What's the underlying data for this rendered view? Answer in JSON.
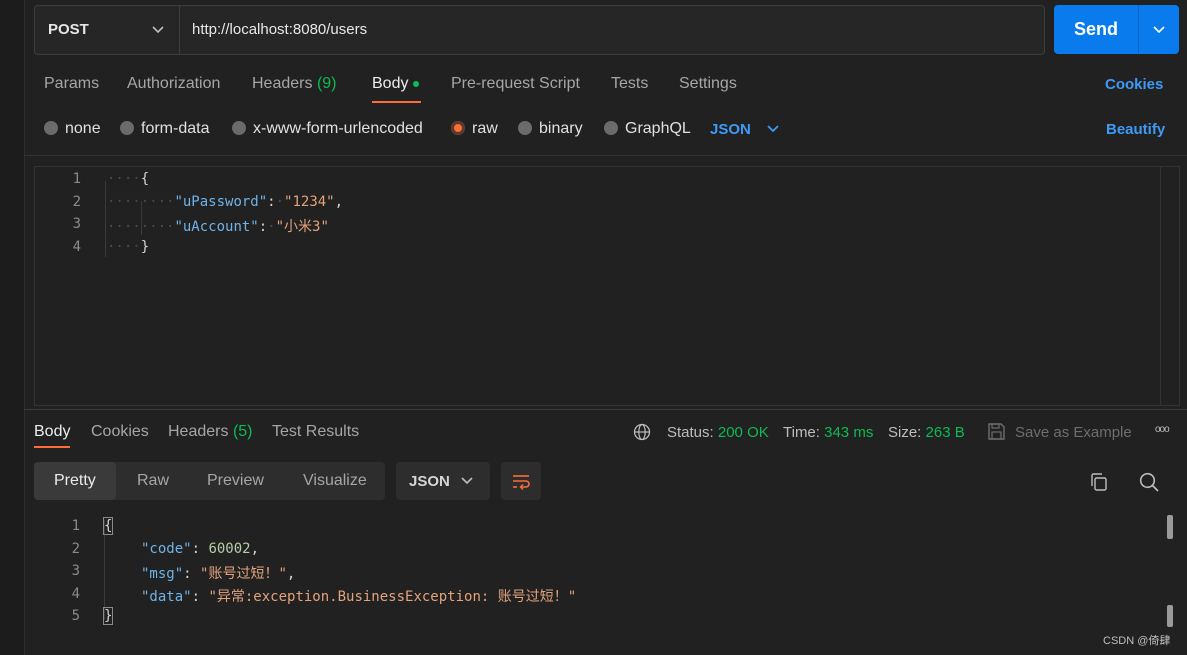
{
  "request": {
    "method": "POST",
    "url": "http://localhost:8080/users",
    "send_label": "Send",
    "tabs": [
      {
        "label": "Params"
      },
      {
        "label": "Authorization"
      },
      {
        "label": "Headers",
        "count": "(9)"
      },
      {
        "label": "Body"
      },
      {
        "label": "Pre-request Script"
      },
      {
        "label": "Tests"
      },
      {
        "label": "Settings"
      }
    ],
    "cookies_label": "Cookies",
    "body_types": [
      "none",
      "form-data",
      "x-www-form-urlencoded",
      "raw",
      "binary",
      "GraphQL"
    ],
    "selected_body_type": "raw",
    "language": "JSON",
    "beautify_label": "Beautify",
    "body_lines": [
      {
        "n": "1",
        "text": "{"
      },
      {
        "n": "2",
        "key": "\"uPassword\"",
        "value": "\"1234\"",
        "trail": ","
      },
      {
        "n": "3",
        "key": "\"uAccount\"",
        "value": "\"小米3\"",
        "trail": ""
      },
      {
        "n": "4",
        "text": "}"
      }
    ]
  },
  "response": {
    "tabs": [
      {
        "label": "Body"
      },
      {
        "label": "Cookies"
      },
      {
        "label": "Headers",
        "count": "(5)"
      },
      {
        "label": "Test Results"
      }
    ],
    "status_label": "Status:",
    "status_value": "200 OK",
    "time_label": "Time:",
    "time_value": "343 ms",
    "size_label": "Size:",
    "size_value": "263 B",
    "save_example_label": "Save as Example",
    "more_label": "ooo",
    "view_modes": [
      "Pretty",
      "Raw",
      "Preview",
      "Visualize"
    ],
    "format": "JSON",
    "body_lines": [
      {
        "n": "1",
        "text": "{"
      },
      {
        "n": "2",
        "key": "\"code\"",
        "value": "60002",
        "trail": ","
      },
      {
        "n": "3",
        "key": "\"msg\"",
        "value": "\"账号过短！\"",
        "trail": ","
      },
      {
        "n": "4",
        "key": "\"data\"",
        "value": "\"异常:exception.BusinessException: 账号过短！\"",
        "trail": ""
      },
      {
        "n": "5",
        "text": "}"
      }
    ]
  },
  "watermark": "CSDN @倚肆",
  "colors": {
    "accent": "#ff6c37",
    "send": "#097bed",
    "link": "#3d9af7",
    "success": "#0cbb52"
  }
}
